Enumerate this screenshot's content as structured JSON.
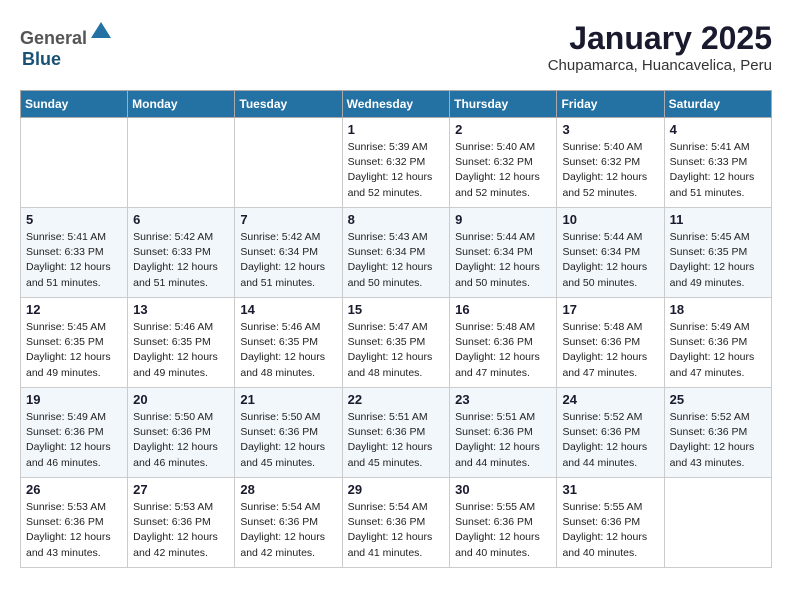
{
  "header": {
    "logo_general": "General",
    "logo_blue": "Blue",
    "title": "January 2025",
    "subtitle": "Chupamarca, Huancavelica, Peru"
  },
  "days_of_week": [
    "Sunday",
    "Monday",
    "Tuesday",
    "Wednesday",
    "Thursday",
    "Friday",
    "Saturday"
  ],
  "weeks": [
    [
      {
        "day": "",
        "info": ""
      },
      {
        "day": "",
        "info": ""
      },
      {
        "day": "",
        "info": ""
      },
      {
        "day": "1",
        "info": "Sunrise: 5:39 AM\nSunset: 6:32 PM\nDaylight: 12 hours\nand 52 minutes."
      },
      {
        "day": "2",
        "info": "Sunrise: 5:40 AM\nSunset: 6:32 PM\nDaylight: 12 hours\nand 52 minutes."
      },
      {
        "day": "3",
        "info": "Sunrise: 5:40 AM\nSunset: 6:32 PM\nDaylight: 12 hours\nand 52 minutes."
      },
      {
        "day": "4",
        "info": "Sunrise: 5:41 AM\nSunset: 6:33 PM\nDaylight: 12 hours\nand 51 minutes."
      }
    ],
    [
      {
        "day": "5",
        "info": "Sunrise: 5:41 AM\nSunset: 6:33 PM\nDaylight: 12 hours\nand 51 minutes."
      },
      {
        "day": "6",
        "info": "Sunrise: 5:42 AM\nSunset: 6:33 PM\nDaylight: 12 hours\nand 51 minutes."
      },
      {
        "day": "7",
        "info": "Sunrise: 5:42 AM\nSunset: 6:34 PM\nDaylight: 12 hours\nand 51 minutes."
      },
      {
        "day": "8",
        "info": "Sunrise: 5:43 AM\nSunset: 6:34 PM\nDaylight: 12 hours\nand 50 minutes."
      },
      {
        "day": "9",
        "info": "Sunrise: 5:44 AM\nSunset: 6:34 PM\nDaylight: 12 hours\nand 50 minutes."
      },
      {
        "day": "10",
        "info": "Sunrise: 5:44 AM\nSunset: 6:34 PM\nDaylight: 12 hours\nand 50 minutes."
      },
      {
        "day": "11",
        "info": "Sunrise: 5:45 AM\nSunset: 6:35 PM\nDaylight: 12 hours\nand 49 minutes."
      }
    ],
    [
      {
        "day": "12",
        "info": "Sunrise: 5:45 AM\nSunset: 6:35 PM\nDaylight: 12 hours\nand 49 minutes."
      },
      {
        "day": "13",
        "info": "Sunrise: 5:46 AM\nSunset: 6:35 PM\nDaylight: 12 hours\nand 49 minutes."
      },
      {
        "day": "14",
        "info": "Sunrise: 5:46 AM\nSunset: 6:35 PM\nDaylight: 12 hours\nand 48 minutes."
      },
      {
        "day": "15",
        "info": "Sunrise: 5:47 AM\nSunset: 6:35 PM\nDaylight: 12 hours\nand 48 minutes."
      },
      {
        "day": "16",
        "info": "Sunrise: 5:48 AM\nSunset: 6:36 PM\nDaylight: 12 hours\nand 47 minutes."
      },
      {
        "day": "17",
        "info": "Sunrise: 5:48 AM\nSunset: 6:36 PM\nDaylight: 12 hours\nand 47 minutes."
      },
      {
        "day": "18",
        "info": "Sunrise: 5:49 AM\nSunset: 6:36 PM\nDaylight: 12 hours\nand 47 minutes."
      }
    ],
    [
      {
        "day": "19",
        "info": "Sunrise: 5:49 AM\nSunset: 6:36 PM\nDaylight: 12 hours\nand 46 minutes."
      },
      {
        "day": "20",
        "info": "Sunrise: 5:50 AM\nSunset: 6:36 PM\nDaylight: 12 hours\nand 46 minutes."
      },
      {
        "day": "21",
        "info": "Sunrise: 5:50 AM\nSunset: 6:36 PM\nDaylight: 12 hours\nand 45 minutes."
      },
      {
        "day": "22",
        "info": "Sunrise: 5:51 AM\nSunset: 6:36 PM\nDaylight: 12 hours\nand 45 minutes."
      },
      {
        "day": "23",
        "info": "Sunrise: 5:51 AM\nSunset: 6:36 PM\nDaylight: 12 hours\nand 44 minutes."
      },
      {
        "day": "24",
        "info": "Sunrise: 5:52 AM\nSunset: 6:36 PM\nDaylight: 12 hours\nand 44 minutes."
      },
      {
        "day": "25",
        "info": "Sunrise: 5:52 AM\nSunset: 6:36 PM\nDaylight: 12 hours\nand 43 minutes."
      }
    ],
    [
      {
        "day": "26",
        "info": "Sunrise: 5:53 AM\nSunset: 6:36 PM\nDaylight: 12 hours\nand 43 minutes."
      },
      {
        "day": "27",
        "info": "Sunrise: 5:53 AM\nSunset: 6:36 PM\nDaylight: 12 hours\nand 42 minutes."
      },
      {
        "day": "28",
        "info": "Sunrise: 5:54 AM\nSunset: 6:36 PM\nDaylight: 12 hours\nand 42 minutes."
      },
      {
        "day": "29",
        "info": "Sunrise: 5:54 AM\nSunset: 6:36 PM\nDaylight: 12 hours\nand 41 minutes."
      },
      {
        "day": "30",
        "info": "Sunrise: 5:55 AM\nSunset: 6:36 PM\nDaylight: 12 hours\nand 40 minutes."
      },
      {
        "day": "31",
        "info": "Sunrise: 5:55 AM\nSunset: 6:36 PM\nDaylight: 12 hours\nand 40 minutes."
      },
      {
        "day": "",
        "info": ""
      }
    ]
  ]
}
